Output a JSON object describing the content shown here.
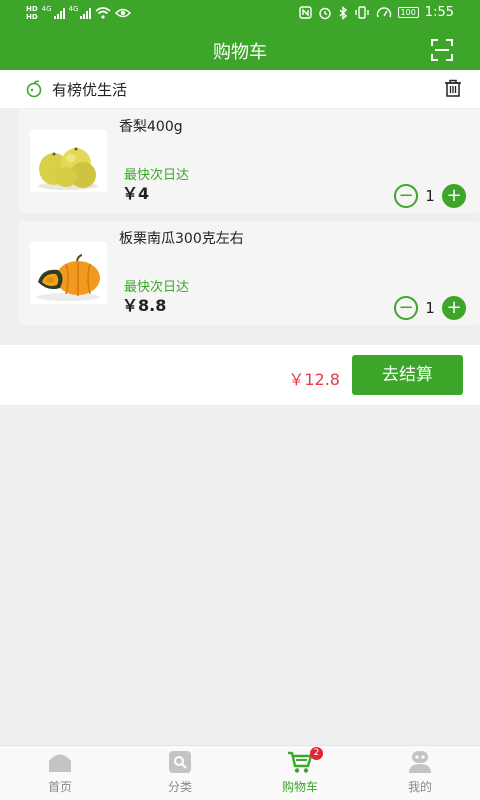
{
  "status_bar": {
    "sim1": "HD",
    "sim2": "HD",
    "net1": "4G",
    "net2": "4G",
    "battery": "100",
    "time": "1:55"
  },
  "header": {
    "title": "购物车"
  },
  "shop": {
    "name": "有榜优生活"
  },
  "cart_items": [
    {
      "name": "香梨400g",
      "shipping": "最快次日达",
      "price": "￥4",
      "quantity": "1"
    },
    {
      "name": "板栗南瓜300克左右",
      "shipping": "最快次日达",
      "price": "￥8.8",
      "quantity": "1"
    }
  ],
  "checkout": {
    "total": "￥12.8",
    "button_label": "去结算"
  },
  "tabbar": {
    "items": [
      {
        "label": "首页",
        "icon": "home-icon"
      },
      {
        "label": "分类",
        "icon": "category-icon"
      },
      {
        "label": "购物车",
        "icon": "cart-icon",
        "badge": "2"
      },
      {
        "label": "我的",
        "icon": "profile-icon"
      }
    ]
  },
  "colors": {
    "brand_green": "#3ca52a",
    "price_red": "#e83a4a",
    "badge_red": "#e3262d"
  }
}
